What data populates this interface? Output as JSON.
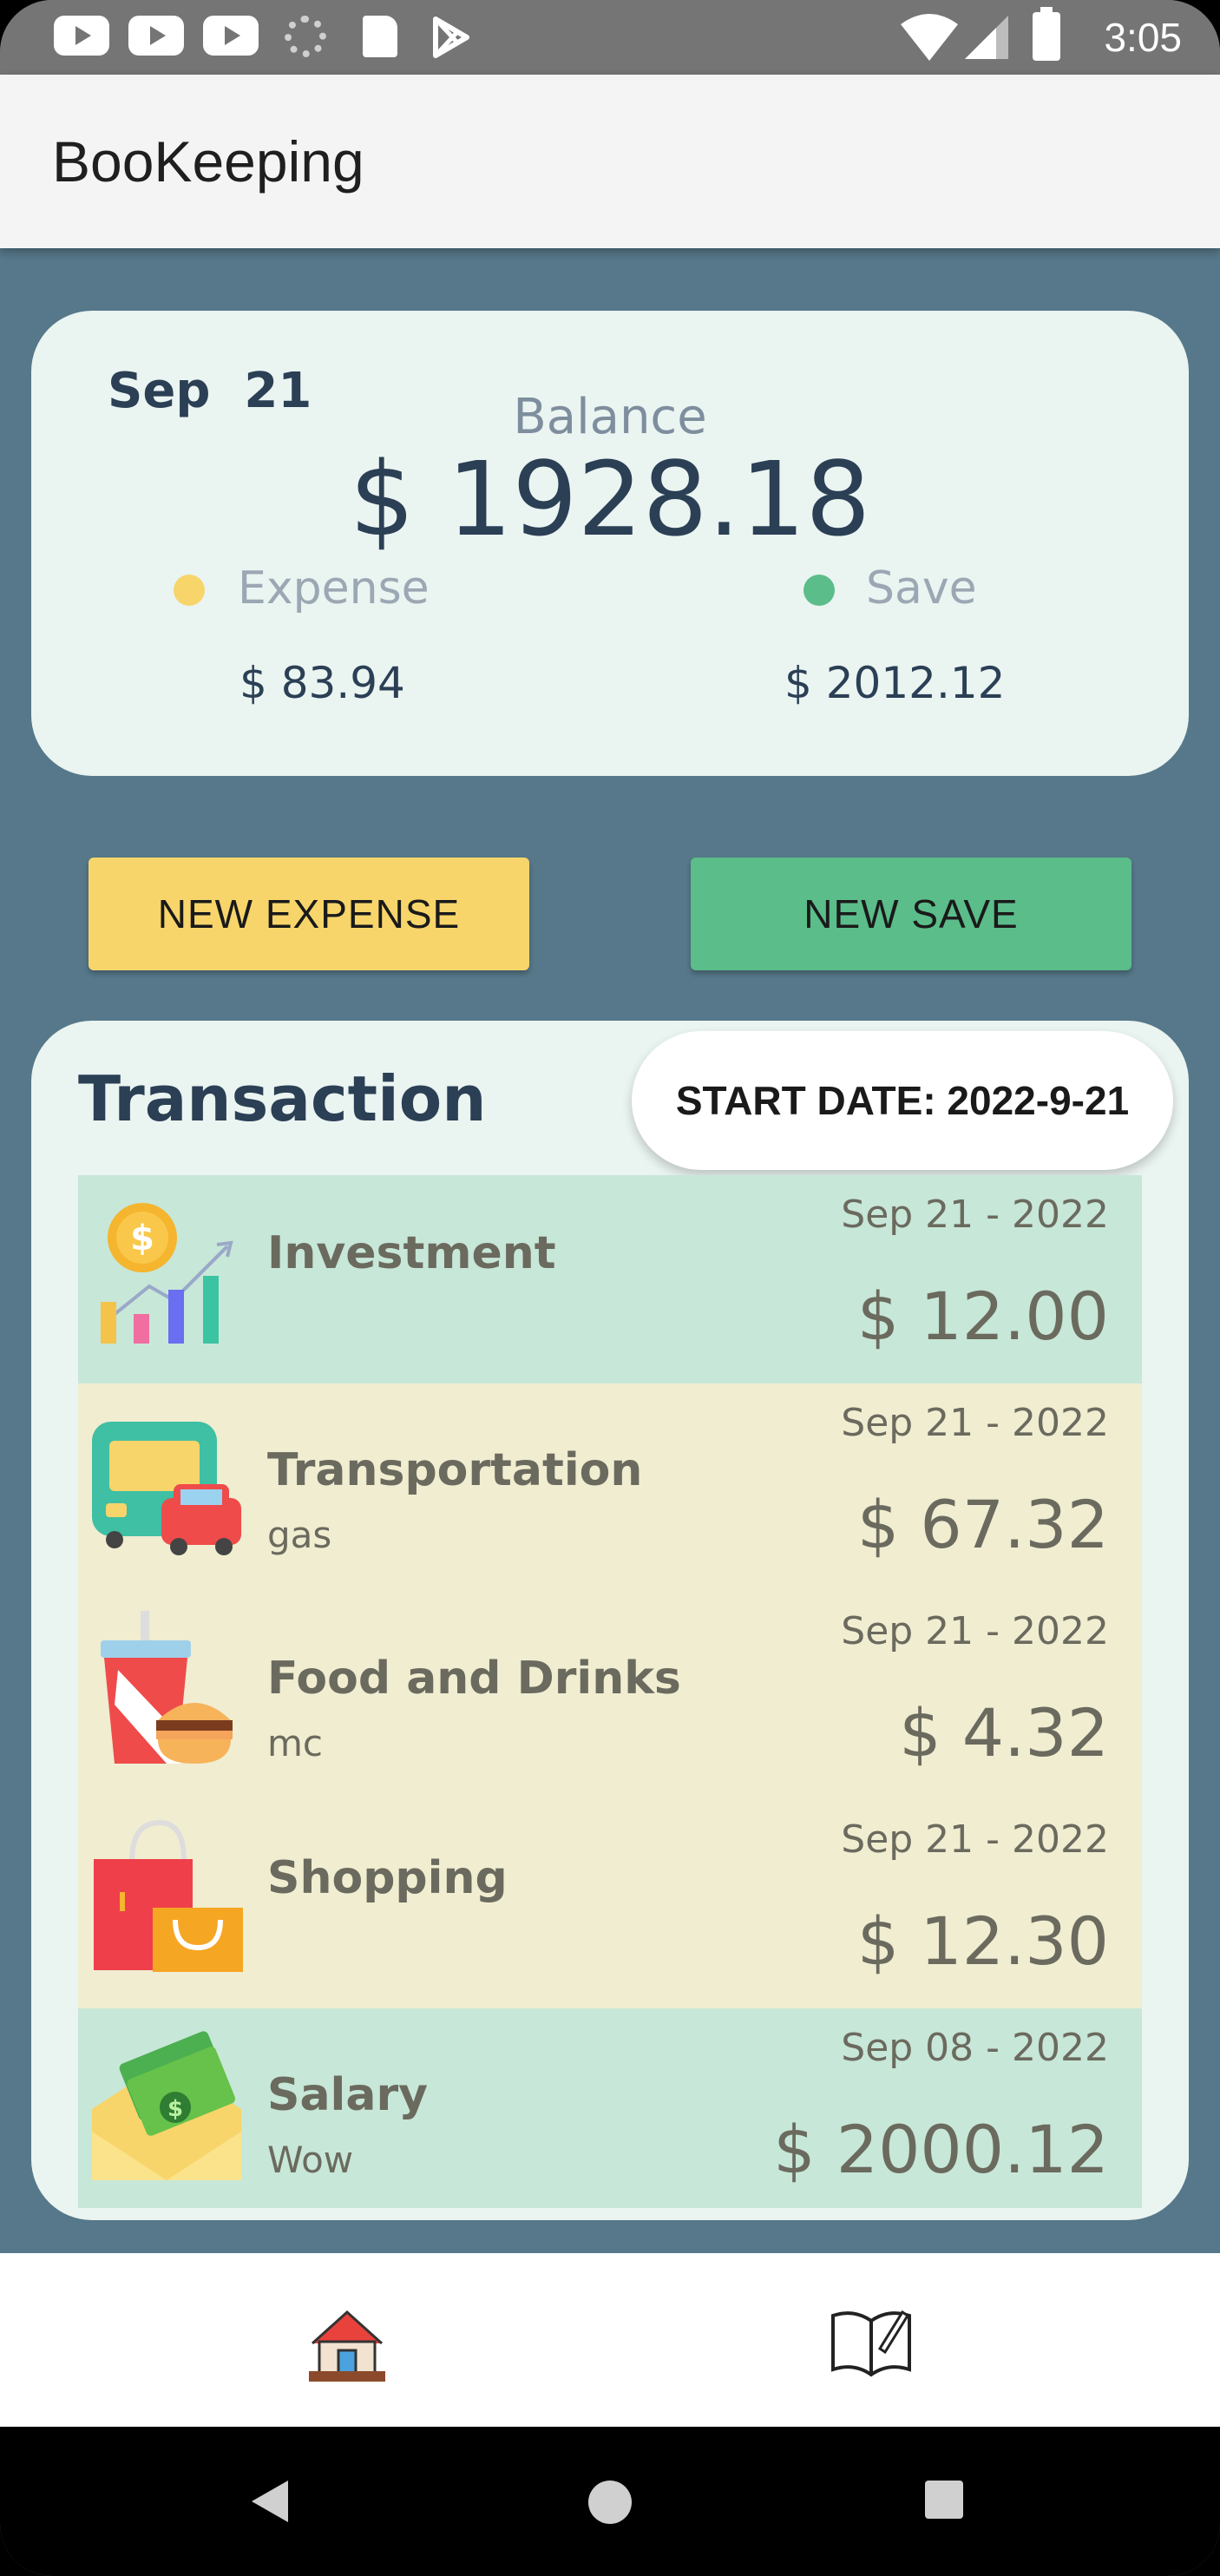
{
  "status_bar": {
    "time": "3:05",
    "icons": [
      "youtube-icon",
      "youtube-icon",
      "youtube-icon",
      "loading-icon",
      "sdcard-icon",
      "play-store-icon",
      "wifi-icon",
      "signal-icon",
      "battery-icon"
    ]
  },
  "app_bar": {
    "title": "BooKeeping"
  },
  "balance_card": {
    "date": "Sep  21",
    "balance_label": "Balance",
    "balance_value": "$ 1928.18",
    "expense_label": "Expense",
    "expense_value": "$ 83.94",
    "save_label": "Save",
    "save_value": "$ 2012.12"
  },
  "actions": {
    "new_expense": "NEW EXPENSE",
    "new_save": "NEW SAVE"
  },
  "transactions": {
    "title": "Transaction",
    "start_date": "START DATE: 2022-9-21",
    "items": [
      {
        "category": "Investment",
        "note": "",
        "date": "Sep 21 - 2022",
        "amount": "$ 12.00",
        "icon": "investment-icon",
        "type": "save"
      },
      {
        "category": "Transportation",
        "note": "gas",
        "date": "Sep 21 - 2022",
        "amount": "$ 67.32",
        "icon": "transportation-icon",
        "type": "expense"
      },
      {
        "category": "Food and Drinks",
        "note": "mc",
        "date": "Sep 21 - 2022",
        "amount": "$ 4.32",
        "icon": "food-drinks-icon",
        "type": "expense"
      },
      {
        "category": "Shopping",
        "note": "",
        "date": "Sep 21 - 2022",
        "amount": "$ 12.30",
        "icon": "shopping-icon",
        "type": "expense"
      },
      {
        "category": "Salary",
        "note": "Wow",
        "date": "Sep 08 - 2022",
        "amount": "$ 2000.12",
        "icon": "salary-icon",
        "type": "save"
      }
    ]
  },
  "bottom_nav": {
    "items": [
      "home-icon",
      "book-icon"
    ]
  },
  "colors": {
    "background": "#56788a",
    "expense": "#f7d56a",
    "save": "#5bbd8a",
    "save_row": "#c7e7d8",
    "expense_row": "#f0edd1",
    "text_dark": "#2b3f55"
  }
}
